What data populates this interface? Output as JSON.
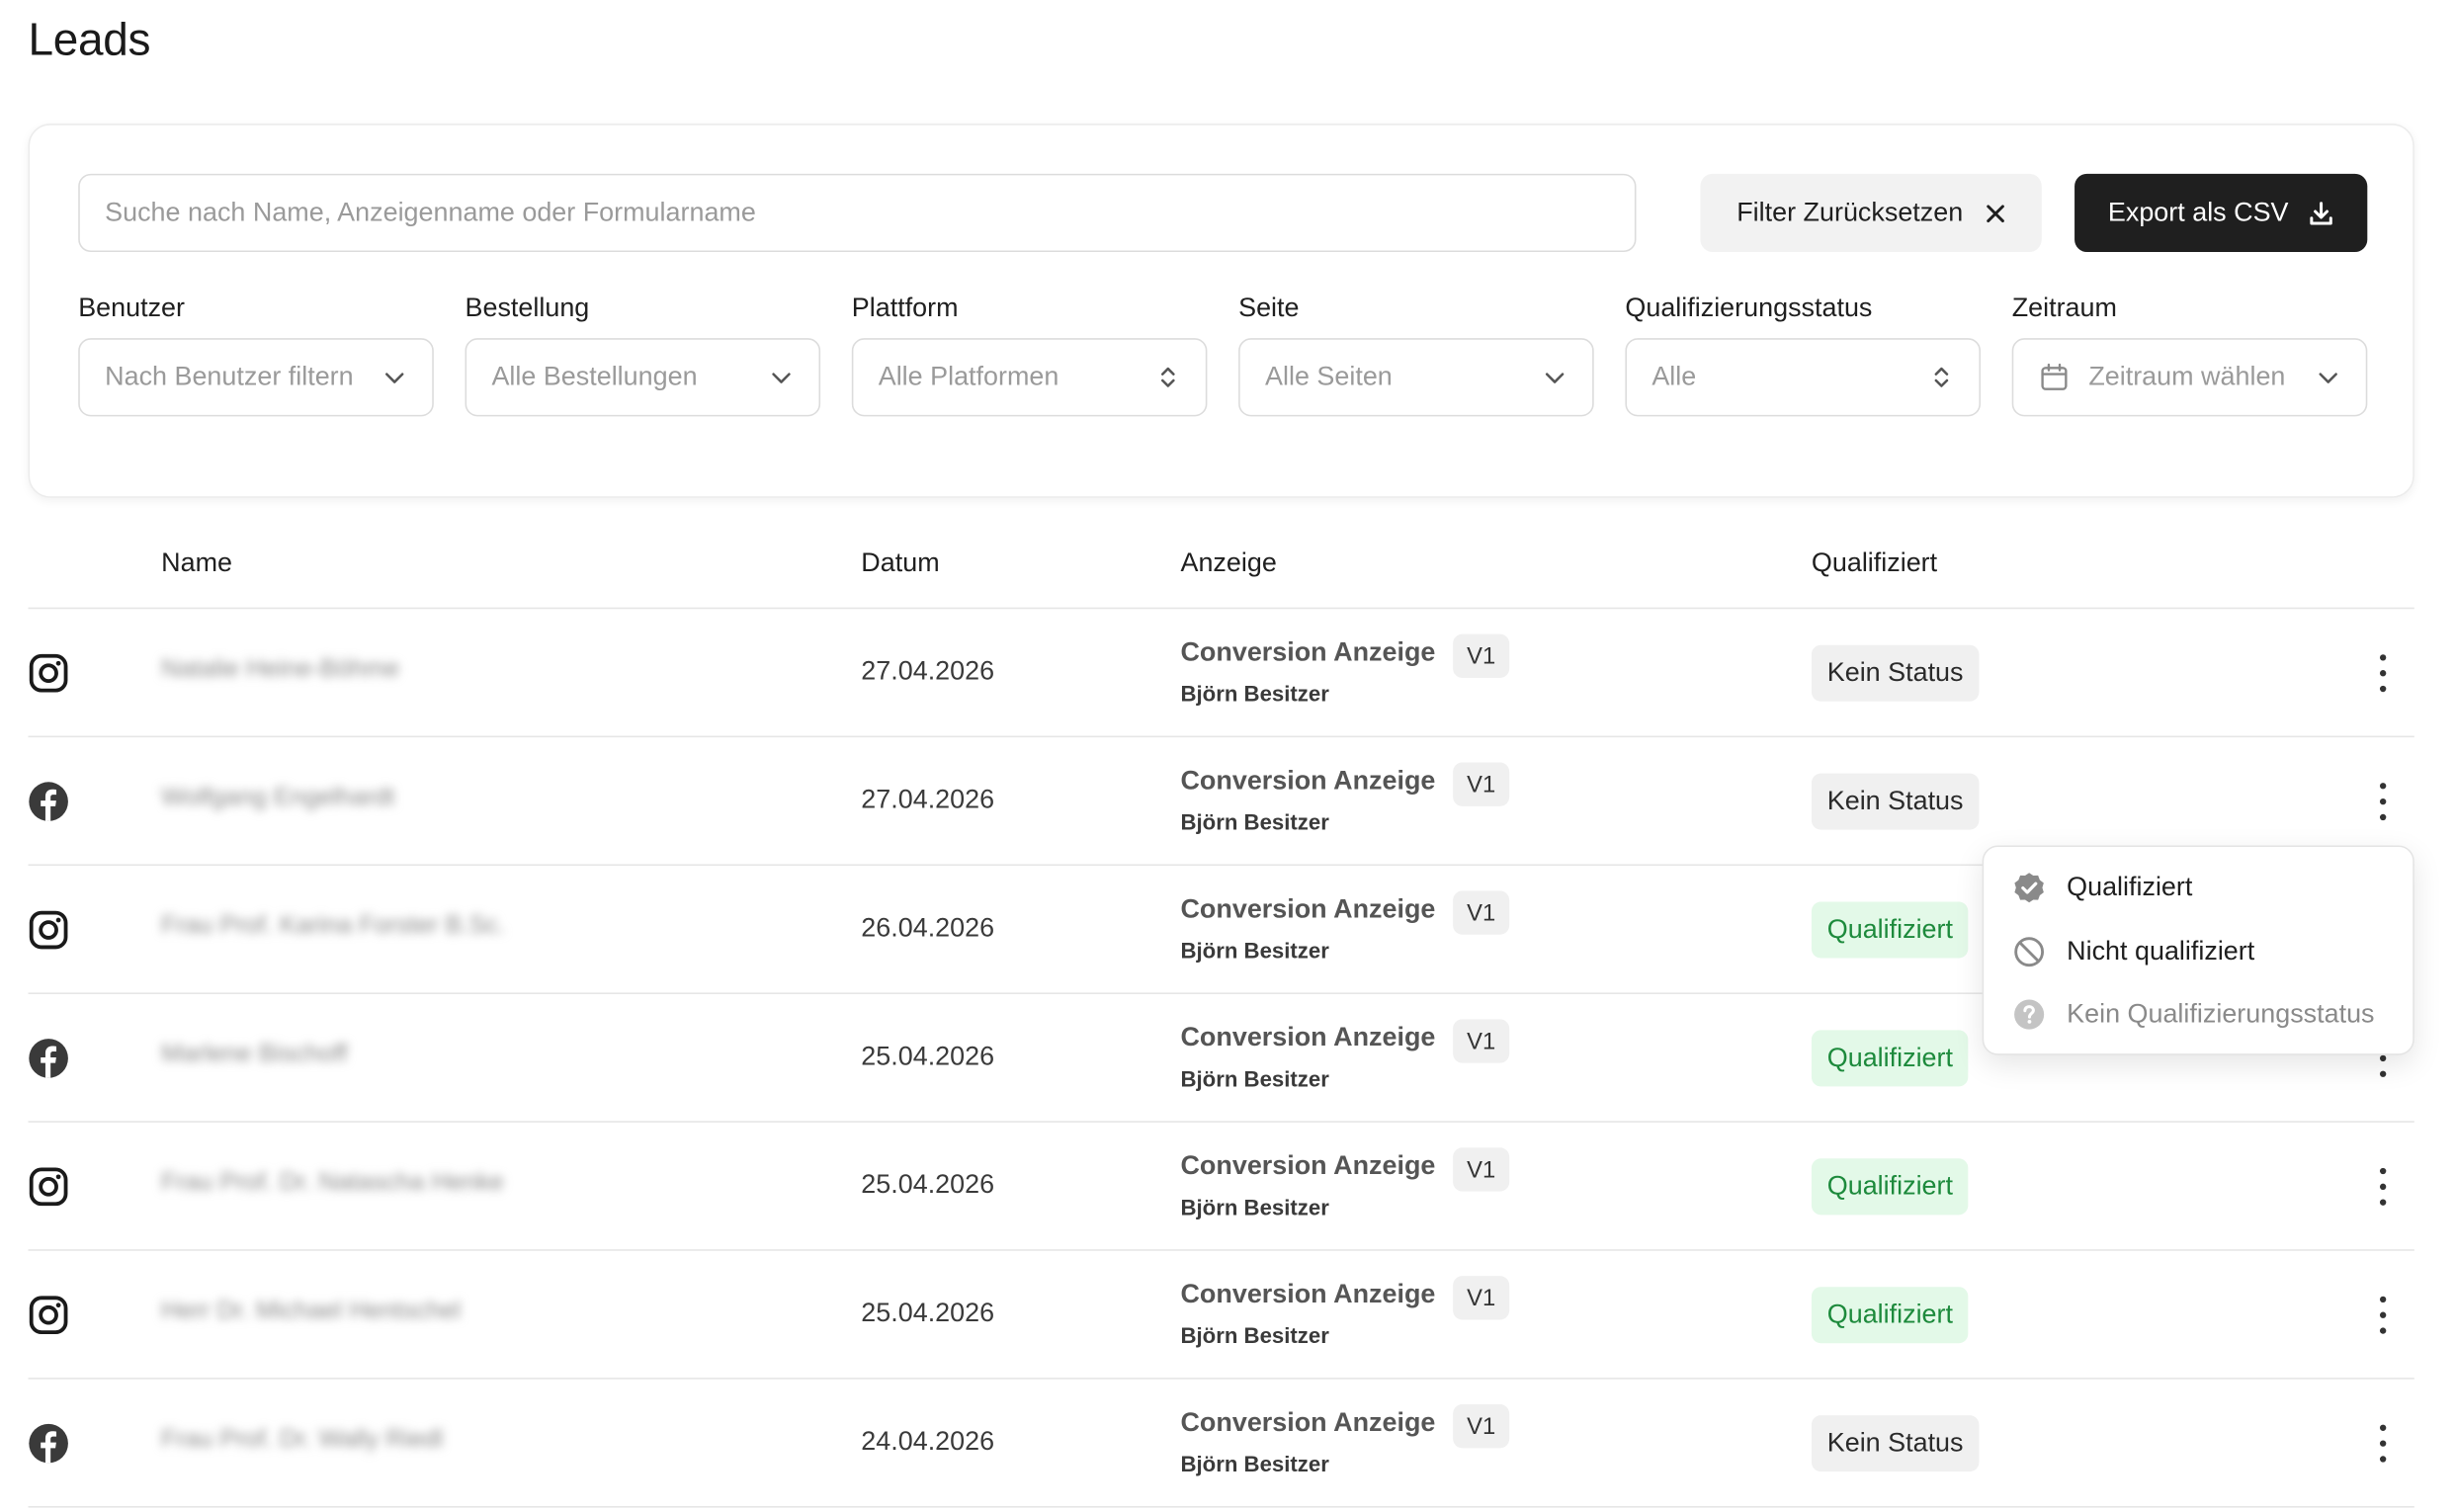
{
  "page": {
    "title": "Leads"
  },
  "toolbar": {
    "search_placeholder": "Suche nach Name, Anzeigenname oder Formularname",
    "reset_label": "Filter Zurücksetzen",
    "export_label": "Export als CSV"
  },
  "filters": [
    {
      "label": "Benutzer",
      "value": "Nach Benutzer filtern",
      "control": "dropdown"
    },
    {
      "label": "Bestellung",
      "value": "Alle Bestellungen",
      "control": "dropdown"
    },
    {
      "label": "Plattform",
      "value": "Alle Platformen",
      "control": "select"
    },
    {
      "label": "Seite",
      "value": "Alle Seiten",
      "control": "dropdown"
    },
    {
      "label": "Qualifizierungsstatus",
      "value": "Alle",
      "control": "select"
    },
    {
      "label": "Zeitraum",
      "value": "Zeitraum wählen",
      "control": "date"
    }
  ],
  "table": {
    "columns": {
      "name": "Name",
      "date": "Datum",
      "ad": "Anzeige",
      "qualified": "Qualifiziert"
    },
    "rows": [
      {
        "platform": "instagram-icon",
        "name": "Natalie Heine-Böhme",
        "date": "27.04.2026",
        "ad": "Conversion Anzeige",
        "version": "V1",
        "owner": "Björn Besitzer",
        "status": "Kein Status",
        "status_type": "none"
      },
      {
        "platform": "facebook-icon",
        "name": "Wolfgang Engelhardt",
        "date": "27.04.2026",
        "ad": "Conversion Anzeige",
        "version": "V1",
        "owner": "Björn Besitzer",
        "status": "Kein Status",
        "status_type": "none"
      },
      {
        "platform": "instagram-icon",
        "name": "Frau Prof. Karina Forster B.Sc.",
        "date": "26.04.2026",
        "ad": "Conversion Anzeige",
        "version": "V1",
        "owner": "Björn Besitzer",
        "status": "Qualifiziert",
        "status_type": "ok"
      },
      {
        "platform": "facebook-icon",
        "name": "Marlene Bischoff",
        "date": "25.04.2026",
        "ad": "Conversion Anzeige",
        "version": "V1",
        "owner": "Björn Besitzer",
        "status": "Qualifiziert",
        "status_type": "ok"
      },
      {
        "platform": "instagram-icon",
        "name": "Frau Prof. Dr. Natascha Henke",
        "date": "25.04.2026",
        "ad": "Conversion Anzeige",
        "version": "V1",
        "owner": "Björn Besitzer",
        "status": "Qualifiziert",
        "status_type": "ok"
      },
      {
        "platform": "instagram-icon",
        "name": "Herr Dr. Michael Hentschel",
        "date": "25.04.2026",
        "ad": "Conversion Anzeige",
        "version": "V1",
        "owner": "Björn Besitzer",
        "status": "Qualifiziert",
        "status_type": "ok"
      },
      {
        "platform": "facebook-icon",
        "name": "Frau Prof. Dr. Wally Riedl",
        "date": "24.04.2026",
        "ad": "Conversion Anzeige",
        "version": "V1",
        "owner": "Björn Besitzer",
        "status": "Kein Status",
        "status_type": "none"
      }
    ]
  },
  "status_menu": {
    "items": [
      {
        "label": "Qualifiziert",
        "icon": "check-badge-icon",
        "color": "#1f1f1f",
        "icon_color": "#8a8a8a"
      },
      {
        "label": "Nicht qualifiziert",
        "icon": "ban-icon",
        "color": "#1f1f1f",
        "icon_color": "#8a8a8a"
      },
      {
        "label": "Kein Qualifizierungsstatus",
        "icon": "question-icon",
        "color": "#8a8a8a",
        "icon_color": "#c4c4c4"
      }
    ]
  },
  "colors": {
    "qualified_bg": "#e3f9e8",
    "qualified_text": "#1d8a3c",
    "none_bg": "#f0f0f0",
    "export_bg": "#1f1f1f"
  }
}
